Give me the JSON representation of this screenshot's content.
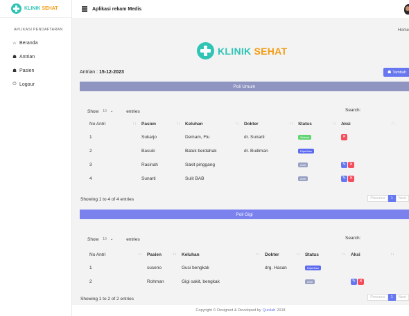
{
  "brand": {
    "klinik": "KLINIK",
    "sehat": "SEHAT"
  },
  "sidebar": {
    "heading": "APLIKASI PENDAFTARAN",
    "items": [
      {
        "label": "Beranda",
        "icon": "home-icon",
        "glyph": "⌂"
      },
      {
        "label": "Antrian",
        "icon": "users-icon",
        "glyph": "☗"
      },
      {
        "label": "Pasien",
        "icon": "users-icon",
        "glyph": "☗"
      },
      {
        "label": "Logour",
        "icon": "power-icon",
        "glyph": "⏻"
      }
    ]
  },
  "topbar": {
    "title": "Aplikasi rekam Medis"
  },
  "breadcrumb": "Home",
  "logo": {
    "klinik": "KLINIK",
    "sehat": "SEHAT"
  },
  "antrian": {
    "label": "Antrian :",
    "date": "15-12-2023"
  },
  "tambah_label": "Tambah",
  "colors": {
    "accent": "#6777ef",
    "teal": "#30c4b5",
    "orange": "#f39c12",
    "danger": "#f44d5c",
    "success": "#63d472"
  },
  "umum": {
    "title": "Poli Umum",
    "length": {
      "show": "Show",
      "value": "10",
      "entries": "entries"
    },
    "search_label": "Search:",
    "columns": [
      "No Antri",
      "Pasien",
      "Keluhan",
      "Dokter",
      "Status",
      "Aksi"
    ],
    "rows": [
      {
        "no": "1",
        "pasien": "Sukarjo",
        "keluhan": "Demam, Flu",
        "dokter": "dr. Sunarti",
        "status": "Selesai",
        "status_color": "green",
        "actions": [
          "delete"
        ]
      },
      {
        "no": "2",
        "pasien": "Basuki",
        "keluhan": "Batuk berdahak",
        "dokter": "dr. Budiman",
        "status": "Diperiksa",
        "status_color": "blue",
        "actions": []
      },
      {
        "no": "3",
        "pasien": "Rasinah",
        "keluhan": "Sakit pinggang",
        "dokter": "",
        "status": "Antri",
        "status_color": "gray",
        "actions": [
          "edit",
          "delete"
        ]
      },
      {
        "no": "4",
        "pasien": "Sunarti",
        "keluhan": "Sulit BAB",
        "dokter": "",
        "status": "Antri",
        "status_color": "gray",
        "actions": [
          "edit",
          "delete"
        ]
      }
    ],
    "info": "Showing 1 to 4 of 4 entries",
    "pager": {
      "prev": "Previous",
      "page": "1",
      "next": "Next"
    }
  },
  "gigi": {
    "title": "Poli Gigi",
    "length": {
      "show": "Show",
      "value": "10",
      "entries": "entries"
    },
    "search_label": "Search:",
    "columns": [
      "No Antri",
      "Pasien",
      "Keluhan",
      "Dokter",
      "Status",
      "Aksi"
    ],
    "rows": [
      {
        "no": "1",
        "pasien": "suseno",
        "keluhan": "Gusi bengkak",
        "dokter": "drg. Hasan",
        "status": "Diperiksa",
        "status_color": "blue",
        "actions": []
      },
      {
        "no": "2",
        "pasien": "Rohman",
        "keluhan": "Gigi sakit, bengkak",
        "dokter": "",
        "status": "Antri",
        "status_color": "gray",
        "actions": [
          "edit",
          "delete"
        ]
      }
    ],
    "info": "Showing 1 to 2 of 2 entries",
    "pager": {
      "prev": "Previous",
      "page": "1",
      "next": "Next"
    }
  },
  "footer": {
    "pre": "Copyright © Designed & Developed by",
    "link": "Quixlab",
    "year": "2018"
  }
}
